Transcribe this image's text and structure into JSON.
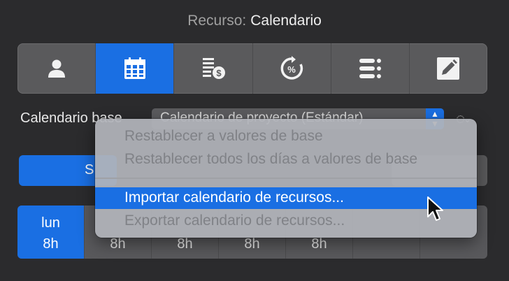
{
  "header": {
    "label": "Recurso:",
    "value": "Calendario"
  },
  "toolbar": {
    "tabs": [
      {
        "name": "person-icon",
        "active": false
      },
      {
        "name": "calendar-icon",
        "active": true
      },
      {
        "name": "cost-icon",
        "active": false
      },
      {
        "name": "percent-cycle-icon",
        "active": false
      },
      {
        "name": "list-icon",
        "active": false
      },
      {
        "name": "pencil-icon",
        "active": false
      }
    ]
  },
  "base": {
    "label": "Calendario base",
    "selected": "Calendario de proyecto (Estándar)"
  },
  "left_button": {
    "label": "S"
  },
  "days": [
    {
      "day": "lun",
      "hours": "8h"
    },
    {
      "day": "",
      "hours": "8h"
    },
    {
      "day": "",
      "hours": "8h"
    },
    {
      "day": "",
      "hours": "8h"
    },
    {
      "day": "",
      "hours": "8h"
    },
    {
      "day": "",
      "hours": ""
    },
    {
      "day": "",
      "hours": ""
    }
  ],
  "menu": {
    "items": [
      {
        "label": "Restablecer a valores de base",
        "enabled": false
      },
      {
        "label": "Restablecer todos los días a valores de base",
        "enabled": false
      },
      {
        "label": "Importar calendario de recursos...",
        "enabled": true,
        "highlighted": true
      },
      {
        "label": "Exportar calendario de recursos...",
        "enabled": false
      }
    ]
  },
  "colors": {
    "accent": "#1a6fe3",
    "background": "#2b2b2d",
    "menu": "#b2b4ba"
  }
}
